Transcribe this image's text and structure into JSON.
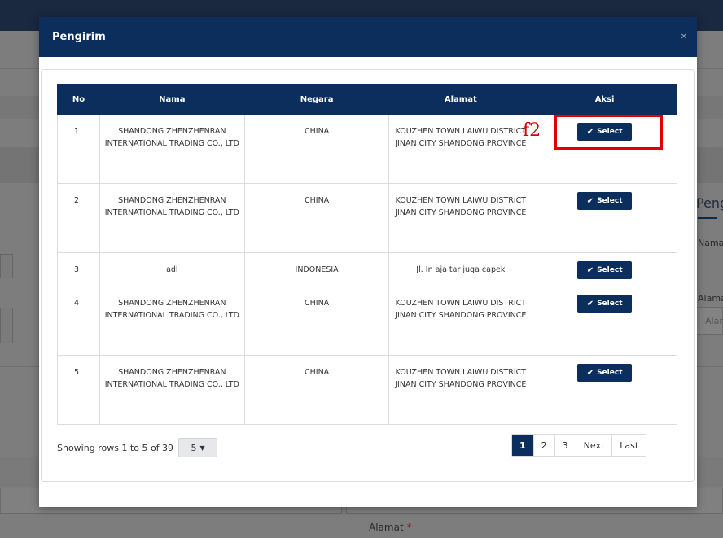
{
  "modal": {
    "title": "Pengirim",
    "close_icon": "close-icon"
  },
  "table": {
    "headers": [
      "No",
      "Nama",
      "Negara",
      "Alamat",
      "Aksi"
    ],
    "rows": [
      {
        "no": "1",
        "nama": "SHANDONG ZHENZHENRAN INTERNATIONAL TRADING CO., LTD",
        "negara": "CHINA",
        "alamat": "KOUZHEN TOWN LAIWU DISTRICT JINAN CITY SHANDONG PROVINCE"
      },
      {
        "no": "2",
        "nama": "SHANDONG ZHENZHENRAN INTERNATIONAL TRADING CO., LTD",
        "negara": "CHINA",
        "alamat": "KOUZHEN TOWN LAIWU DISTRICT JINAN CITY SHANDONG PROVINCE"
      },
      {
        "no": "3",
        "nama": "adl",
        "negara": "INDONESIA",
        "alamat": "Jl. In aja tar juga capek"
      },
      {
        "no": "4",
        "nama": "SHANDONG ZHENZHENRAN INTERNATIONAL TRADING CO., LTD",
        "negara": "CHINA",
        "alamat": "KOUZHEN TOWN LAIWU DISTRICT JINAN CITY SHANDONG PROVINCE"
      },
      {
        "no": "5",
        "nama": "SHANDONG ZHENZHENRAN INTERNATIONAL TRADING CO., LTD",
        "negara": "CHINA",
        "alamat": "KOUZHEN TOWN LAIWU DISTRICT JINAN CITY SHANDONG PROVINCE"
      }
    ],
    "select_label": "Select",
    "select_icon": "check-icon"
  },
  "footer": {
    "showing": "Showing rows 1 to 5 of 39",
    "page_size": "5",
    "pages": [
      "1",
      "2",
      "3",
      "Next",
      "Last"
    ],
    "active_page": "1"
  },
  "annotation": {
    "label": "f2",
    "color": "#e00000"
  },
  "background": {
    "right_title": "Peng",
    "right_label_1": "Nama",
    "right_label_2": "Alama",
    "right_placeholder": "Alar",
    "alamat_label": "Alamat",
    "required_mark": "*"
  },
  "colors": {
    "primary": "#0b2e5c",
    "annotation": "#e00000"
  }
}
